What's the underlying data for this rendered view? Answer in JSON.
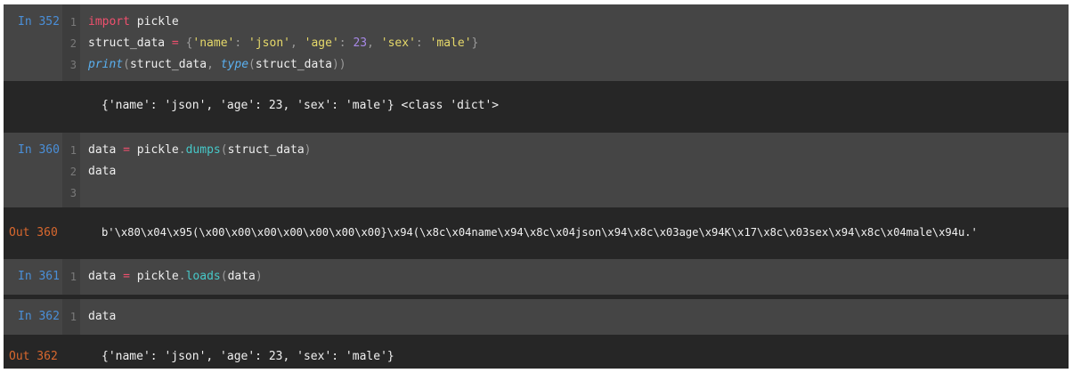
{
  "cells": [
    {
      "in_prompt": "In 352",
      "line_numbers": [
        "1",
        "2",
        "3"
      ],
      "lines": [
        {
          "t1": "import",
          "t2": " pickle"
        },
        {
          "t1": "struct_data",
          "t2": " = ",
          "t3": "{",
          "t4": "'name'",
          "t5": ": ",
          "t6": "'json'",
          "t7": ", ",
          "t8": "'age'",
          "t9": ": ",
          "t10": "23",
          "t11": ", ",
          "t12": "'sex'",
          "t13": ": ",
          "t14": "'male'",
          "t15": "}"
        },
        {
          "t1": "print",
          "t2": "(",
          "t3": "struct_data",
          "t4": ", ",
          "t5": "type",
          "t6": "(",
          "t7": "struct_data",
          "t8": "))"
        }
      ],
      "output_text": "{'name': 'json', 'age': 23, 'sex': 'male'} <class 'dict'>"
    },
    {
      "in_prompt": "In 360",
      "line_numbers": [
        "1",
        "2",
        "3"
      ],
      "lines": [
        {
          "t1": "data",
          "t2": " = ",
          "t3": "pickle",
          "t4": ".",
          "t5": "dumps",
          "t6": "(",
          "t7": "struct_data",
          "t8": ")"
        },
        {
          "t1": "data"
        }
      ],
      "out_prompt": "Out 360",
      "output_text": "b'\\x80\\x04\\x95(\\x00\\x00\\x00\\x00\\x00\\x00\\x00}\\x94(\\x8c\\x04name\\x94\\x8c\\x04json\\x94\\x8c\\x03age\\x94K\\x17\\x8c\\x03sex\\x94\\x8c\\x04male\\x94u.'"
    },
    {
      "in_prompt": "In 361",
      "line_numbers": [
        "1"
      ],
      "lines": [
        {
          "t1": "data",
          "t2": " = ",
          "t3": "pickle",
          "t4": ".",
          "t5": "loads",
          "t6": "(",
          "t7": "data",
          "t8": ")"
        }
      ]
    },
    {
      "in_prompt": "In 362",
      "line_numbers": [
        "1"
      ],
      "lines": [
        {
          "t1": "data"
        }
      ],
      "out_prompt": "Out 362",
      "output_text": "{'name': 'json', 'age': 23, 'sex': 'male'}"
    }
  ]
}
